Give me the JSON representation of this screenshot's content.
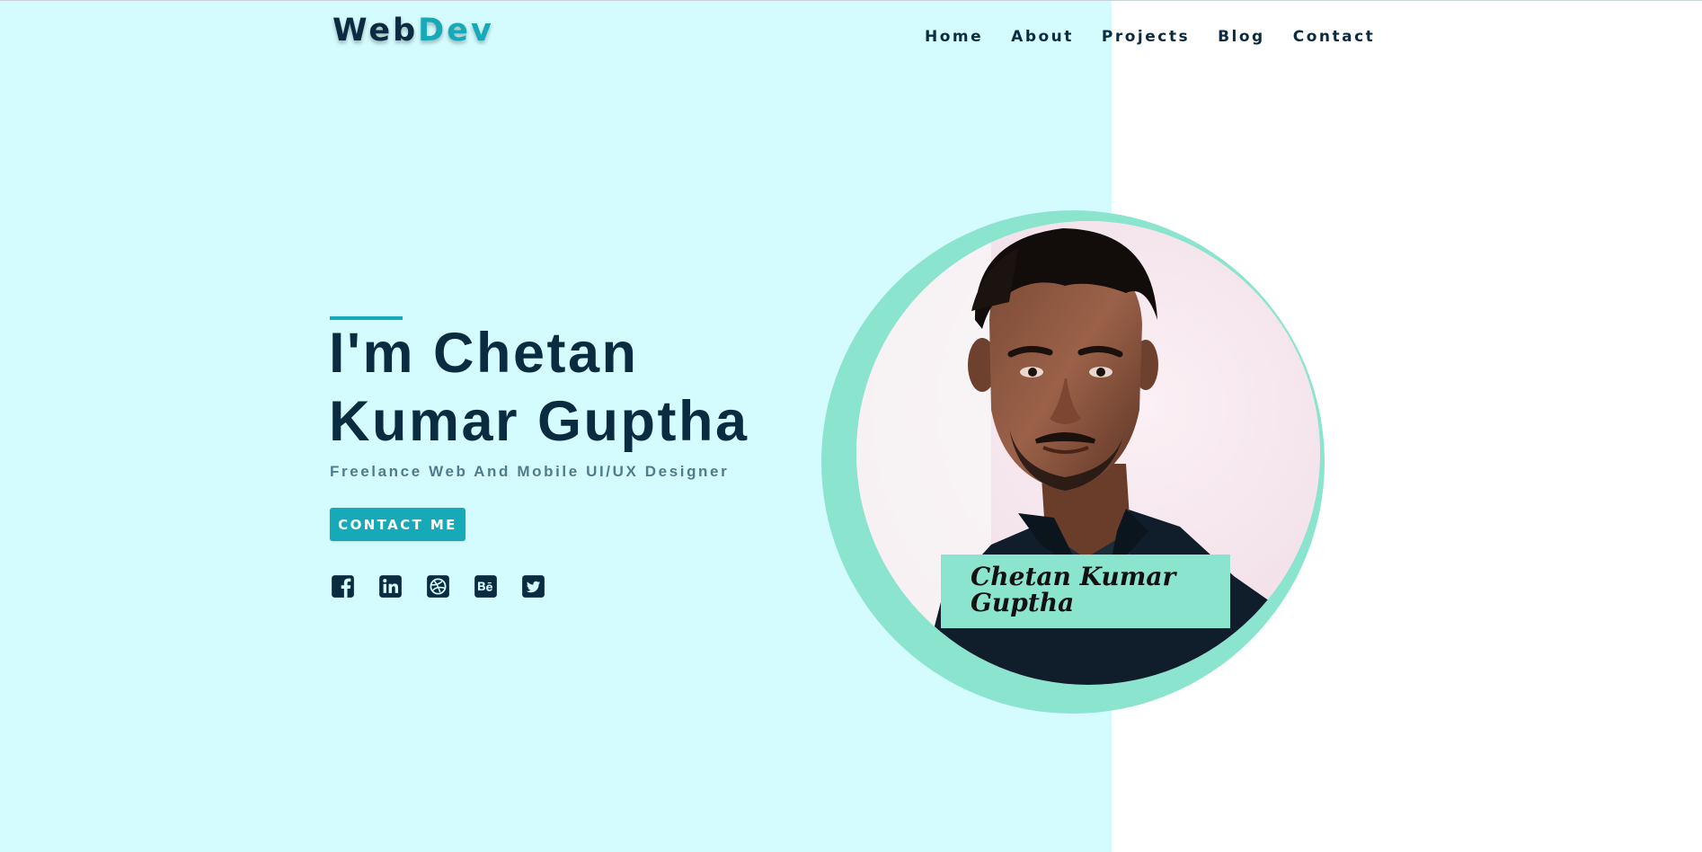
{
  "header": {
    "logo_part1": "Web",
    "logo_part2": "Dev",
    "nav": [
      "Home",
      "About",
      "Projects",
      "Blog",
      "Contact"
    ]
  },
  "hero": {
    "title_line1": "I'm Chetan",
    "title_line2": "Kumar Guptha",
    "subtitle": "Freelance Web And Mobile UI/UX Designer",
    "cta_label": "CONTACT ME",
    "socials": [
      "facebook-icon",
      "linkedin-icon",
      "dribbble-icon",
      "behance-icon",
      "twitter-icon"
    ]
  },
  "portrait": {
    "caption_line1": "Chetan Kumar",
    "caption_line2": "Guptha"
  },
  "colors": {
    "panel_bg": "#d4fbfe",
    "accent": "#16aab8",
    "dark": "#0b2c40",
    "ring": "#8be4ce"
  }
}
